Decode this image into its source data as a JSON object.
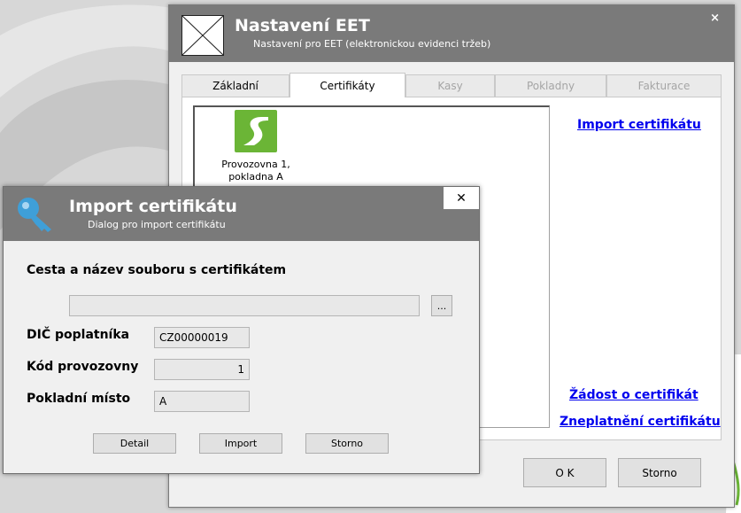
{
  "main_window": {
    "title": "Nastavení EET",
    "subtitle": "Nastavení pro EET (elektronickou evidenci tržeb)",
    "close_glyph": "×",
    "tabs": [
      {
        "label": "Základní",
        "state": "normal"
      },
      {
        "label": "Certifikáty",
        "state": "active"
      },
      {
        "label": "Kasy",
        "state": "disabled"
      },
      {
        "label": "Pokladny",
        "state": "disabled"
      },
      {
        "label": "Fakturace",
        "state": "disabled"
      }
    ],
    "certificates": [
      {
        "label_line1": "Provozovna 1,",
        "label_line2": "pokladna A",
        "icon": "certificate-icon"
      }
    ],
    "links": {
      "import": "Import certifikátu",
      "request": "Žádost o certifikát",
      "revoke": "Zneplatnění certifikátu"
    },
    "buttons": {
      "ok": "O K",
      "cancel": "Storno"
    },
    "colors": {
      "header": "#7a7a7a",
      "link": "#0000ee",
      "cert_icon": "#6bb536"
    }
  },
  "import_dialog": {
    "title": "Import certifikátu",
    "subtitle": "Dialog pro import certifikátu",
    "close_glyph": "✕",
    "file_label": "Cesta a název souboru s certifikátem",
    "file_value": "",
    "browse_label": "...",
    "dic_label": "DIČ poplatníka",
    "dic_value": "CZ00000019",
    "kod_label": "Kód provozovny",
    "kod_value": "1",
    "misto_label": "Pokladní místo",
    "misto_value": "A",
    "buttons": {
      "detail": "Detail",
      "import": "Import",
      "cancel": "Storno"
    },
    "colors": {
      "key_icon": "#3f9fd8"
    }
  }
}
